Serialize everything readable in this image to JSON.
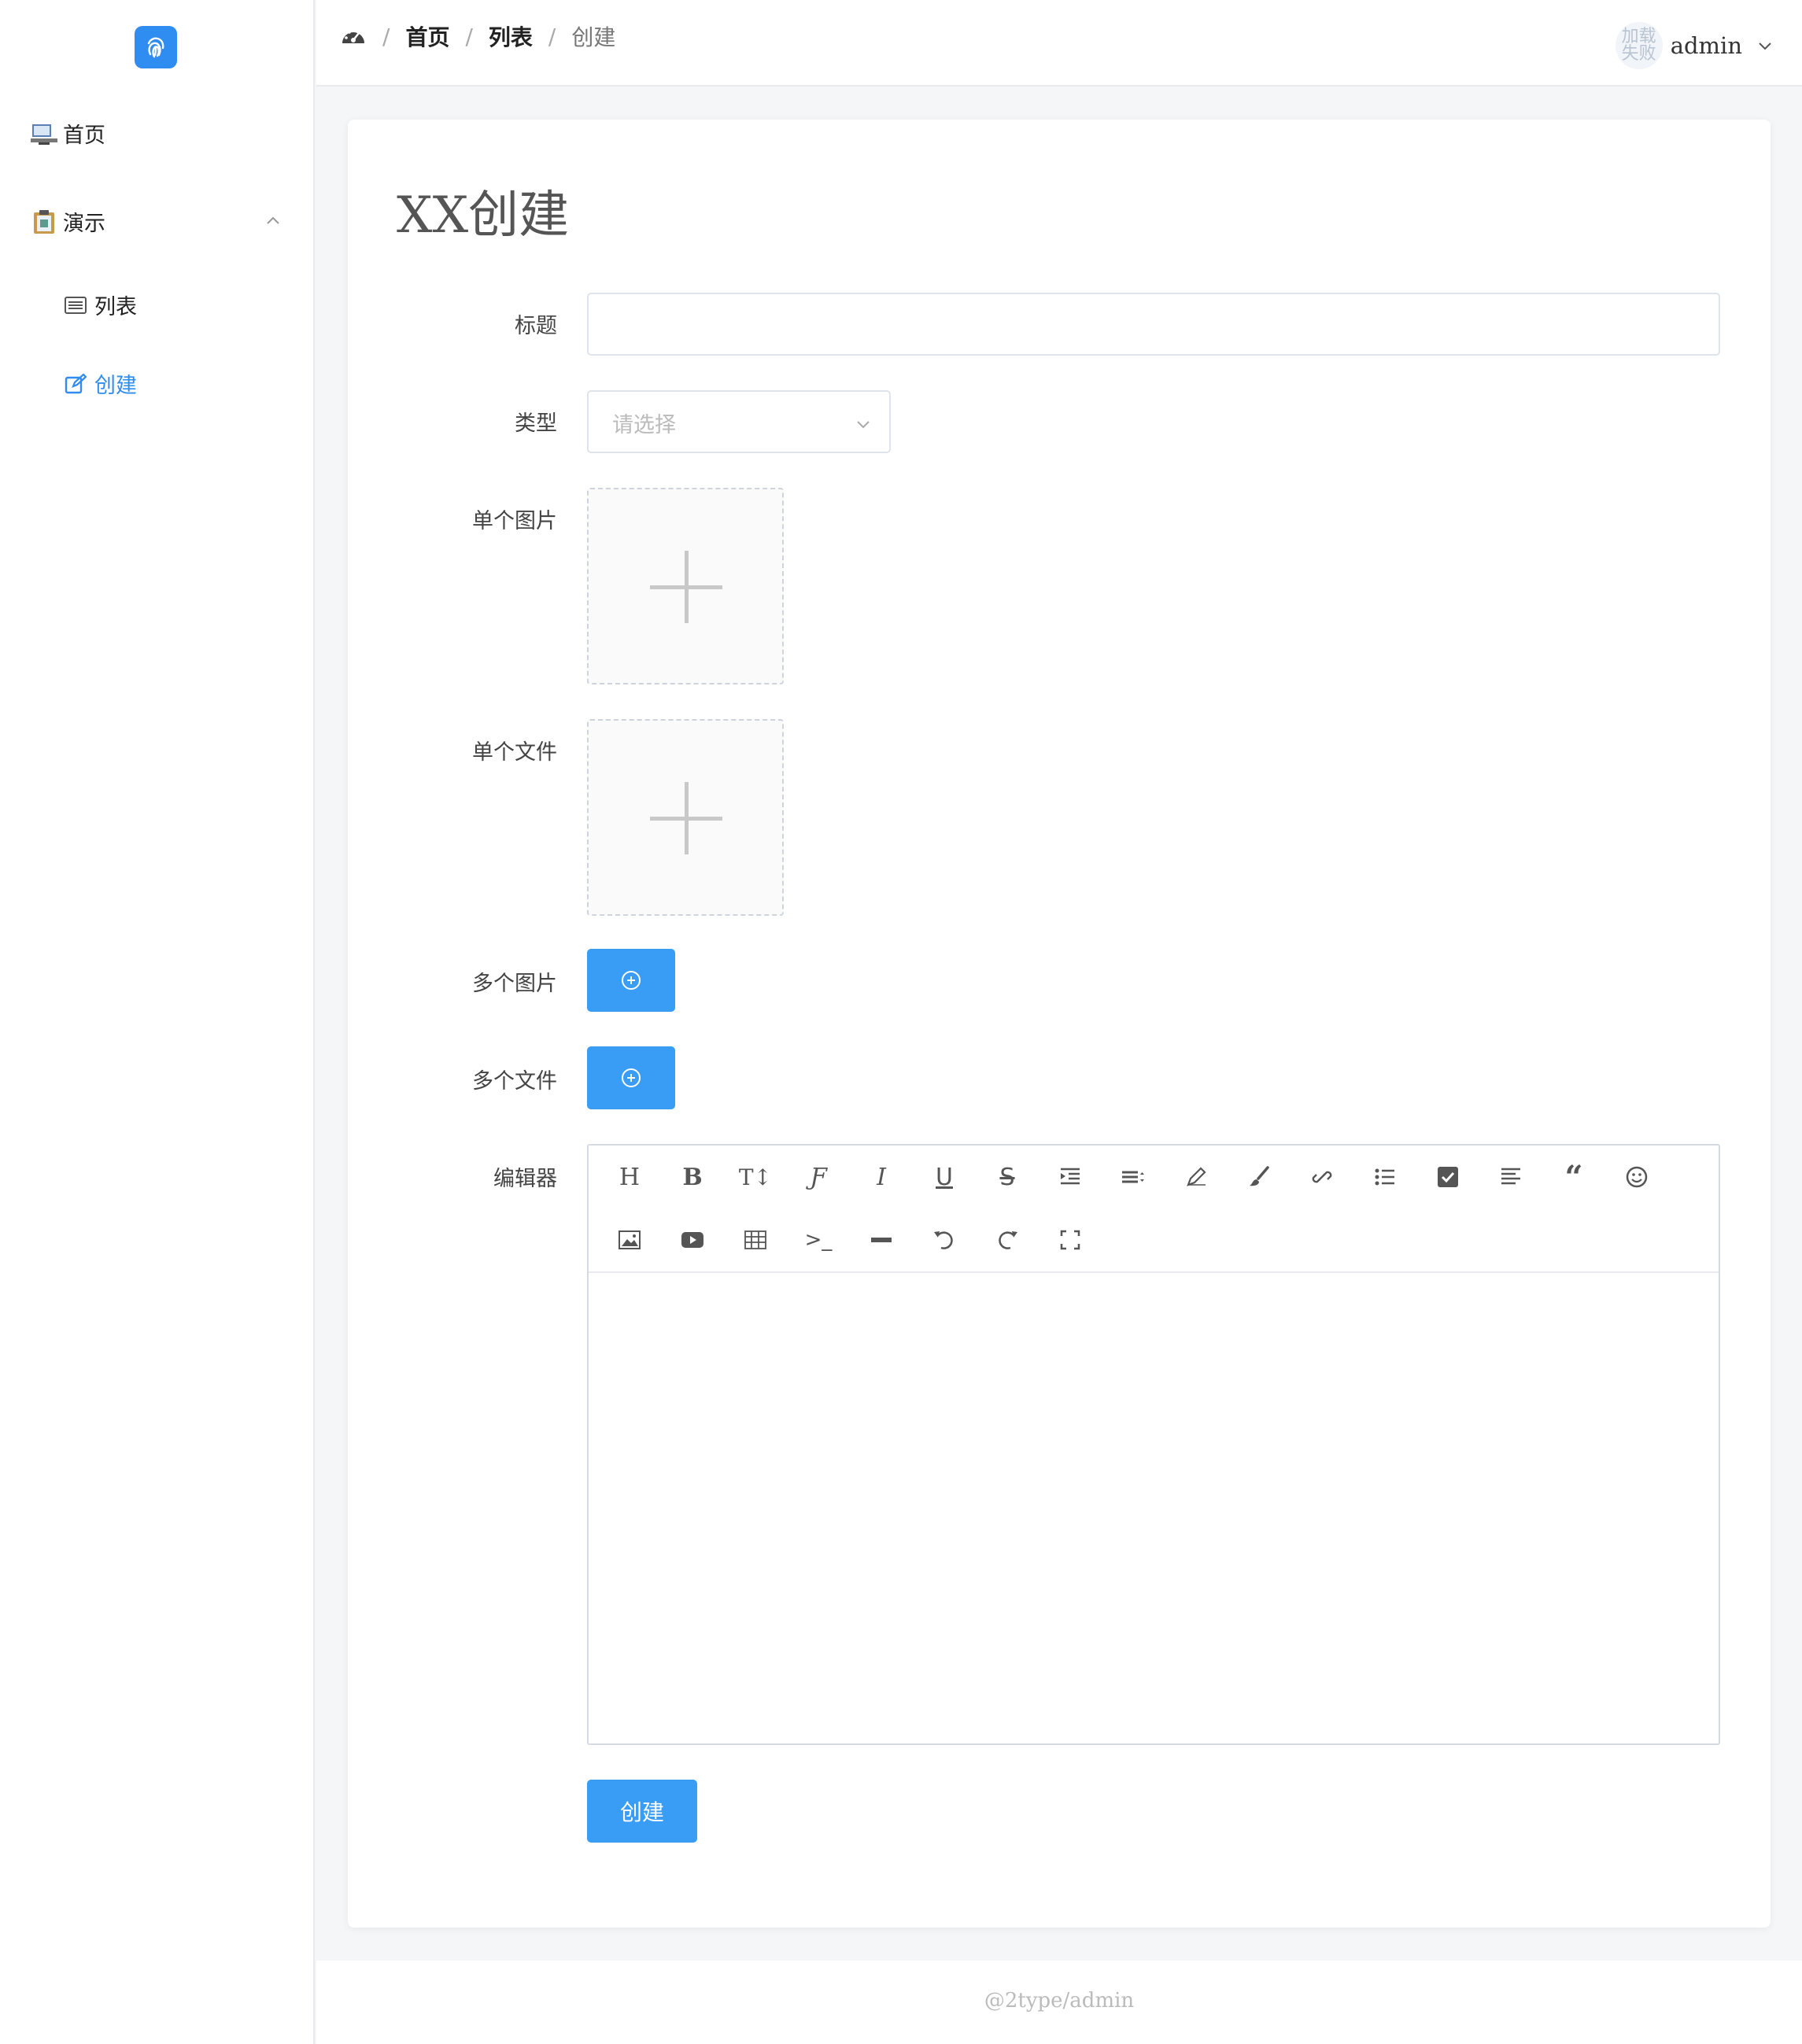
{
  "sidebar": {
    "items": [
      {
        "label": "首页",
        "icon": "computer-icon"
      },
      {
        "label": "演示",
        "icon": "clipboard-icon"
      },
      {
        "label": "列表",
        "icon": "list-icon"
      },
      {
        "label": "创建",
        "icon": "edit-icon"
      }
    ]
  },
  "header": {
    "breadcrumb": [
      "首页",
      "列表",
      "创建"
    ],
    "separator": "/",
    "avatar_text": "加载失败",
    "username": "admin"
  },
  "page": {
    "title": "XX创建"
  },
  "form": {
    "title_label": "标题",
    "title_value": "",
    "type_label": "类型",
    "type_placeholder": "请选择",
    "single_image_label": "单个图片",
    "single_file_label": "单个文件",
    "multi_image_label": "多个图片",
    "multi_file_label": "多个文件",
    "editor_label": "编辑器",
    "editor_toolbar": [
      "heading",
      "bold",
      "text-size",
      "font",
      "italic",
      "underline",
      "strikethrough",
      "indent",
      "line-height",
      "pen",
      "brush",
      "link",
      "unordered-list",
      "checklist",
      "align-left",
      "blockquote",
      "emoji",
      "image",
      "video",
      "table",
      "code",
      "horizontal-rule",
      "undo",
      "redo",
      "fullscreen"
    ],
    "submit_label": "创建"
  },
  "footer": {
    "text": "@2type/admin"
  },
  "colors": {
    "accent": "#2f8cf0",
    "button": "#3a9df5"
  }
}
